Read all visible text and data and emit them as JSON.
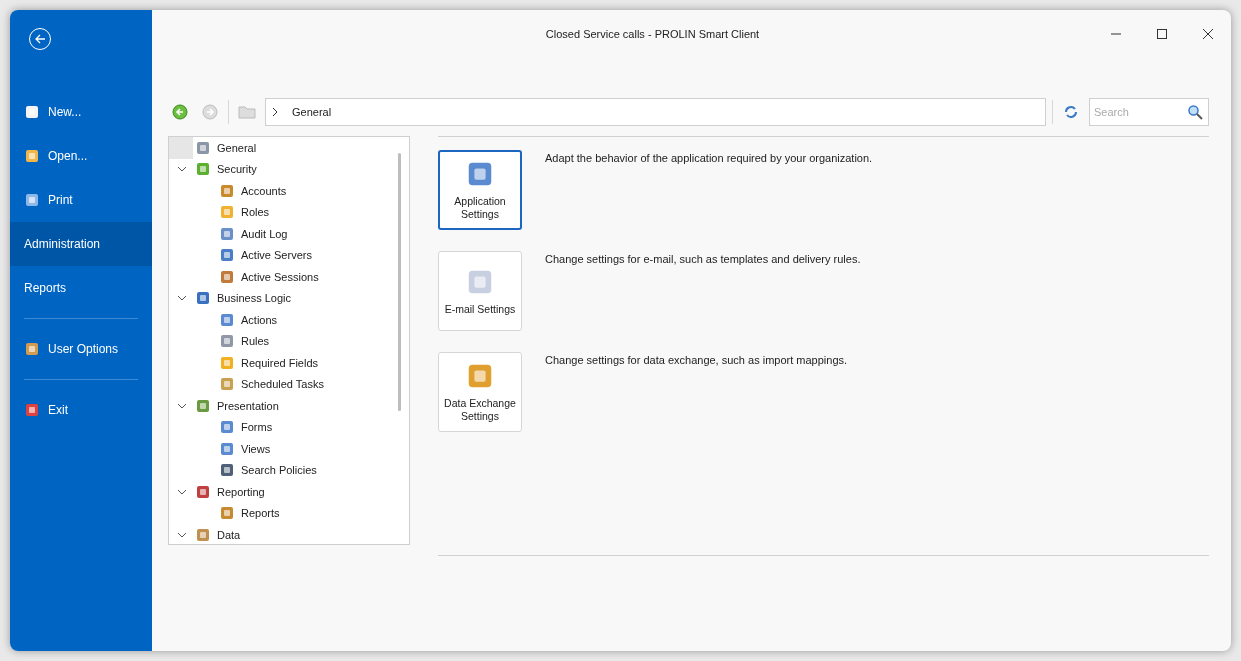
{
  "window": {
    "title": "Closed Service calls - PROLIN Smart Client"
  },
  "sidebar": {
    "items": [
      {
        "kind": "item",
        "label": "New...",
        "selected": false
      },
      {
        "kind": "item",
        "label": "Open...",
        "selected": false
      },
      {
        "kind": "item",
        "label": "Print",
        "selected": false
      },
      {
        "kind": "item",
        "label": "Administration",
        "selected": true
      },
      {
        "kind": "item",
        "label": "Reports",
        "selected": false
      },
      {
        "kind": "divider"
      },
      {
        "kind": "item",
        "label": "User Options",
        "selected": false
      },
      {
        "kind": "divider"
      },
      {
        "kind": "item",
        "label": "Exit",
        "selected": false
      }
    ]
  },
  "toolbar": {
    "breadcrumb": "General",
    "search": {
      "placeholder": "Search"
    }
  },
  "tree": {
    "items": [
      {
        "label": "General",
        "selected": true
      },
      {
        "label": "Security",
        "expanded": true,
        "children": [
          {
            "label": "Accounts"
          },
          {
            "label": "Roles"
          },
          {
            "label": "Audit Log"
          },
          {
            "label": "Active Servers"
          },
          {
            "label": "Active Sessions"
          }
        ]
      },
      {
        "label": "Business Logic",
        "expanded": true,
        "children": [
          {
            "label": "Actions"
          },
          {
            "label": "Rules"
          },
          {
            "label": "Required Fields"
          },
          {
            "label": "Scheduled Tasks"
          }
        ]
      },
      {
        "label": "Presentation",
        "expanded": true,
        "children": [
          {
            "label": "Forms"
          },
          {
            "label": "Views"
          },
          {
            "label": "Search Policies"
          }
        ]
      },
      {
        "label": "Reporting",
        "expanded": true,
        "children": [
          {
            "label": "Reports"
          }
        ]
      },
      {
        "label": "Data",
        "expanded": true
      }
    ]
  },
  "settings": [
    {
      "label": "Application Settings",
      "description": "Adapt the behavior of the application required by your organization.",
      "selected": true
    },
    {
      "label": "E-mail Settings",
      "description": "Change settings for e-mail, such as templates and delivery rules.",
      "selected": false
    },
    {
      "label": "Data Exchange Settings",
      "description": "Change settings for data exchange, such as import mappings.",
      "selected": false
    }
  ]
}
